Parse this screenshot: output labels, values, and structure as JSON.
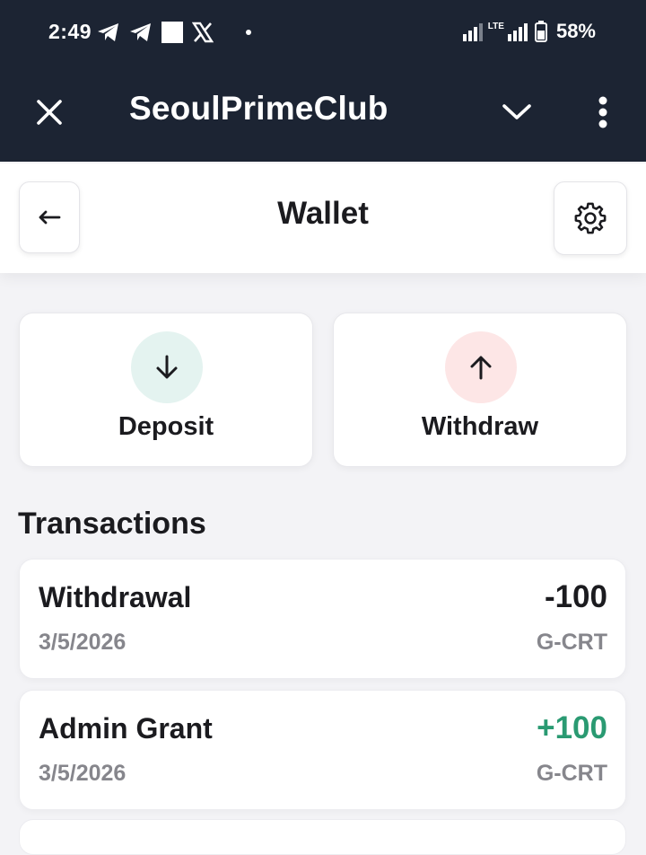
{
  "status_bar": {
    "time": "2:49",
    "battery": "58%",
    "network": "LTE",
    "icons": [
      "telegram-icon",
      "telegram-icon",
      "notification-square-icon",
      "x-logo-icon",
      "dot-icon"
    ]
  },
  "browser": {
    "title": "SeoulPrimeClub"
  },
  "header": {
    "title": "Wallet"
  },
  "actions": [
    {
      "label": "Deposit",
      "icon": "arrow-down-icon",
      "circle_color": "#e4f3f0"
    },
    {
      "label": "Withdraw",
      "icon": "arrow-up-icon",
      "circle_color": "#fde6e6"
    }
  ],
  "transactions": {
    "title": "Transactions",
    "items": [
      {
        "title": "Withdrawal",
        "date": "3/5/2026",
        "amount": "-100",
        "currency": "G-CRT",
        "amount_color": "#1b1b1f"
      },
      {
        "title": "Admin Grant",
        "date": "3/5/2026",
        "amount": "+100",
        "currency": "G-CRT",
        "amount_color": "#2a9a72"
      }
    ]
  },
  "colors": {
    "header_bg": "#1c2433",
    "page_bg": "#f3f3f6",
    "positive": "#2a9a72"
  }
}
